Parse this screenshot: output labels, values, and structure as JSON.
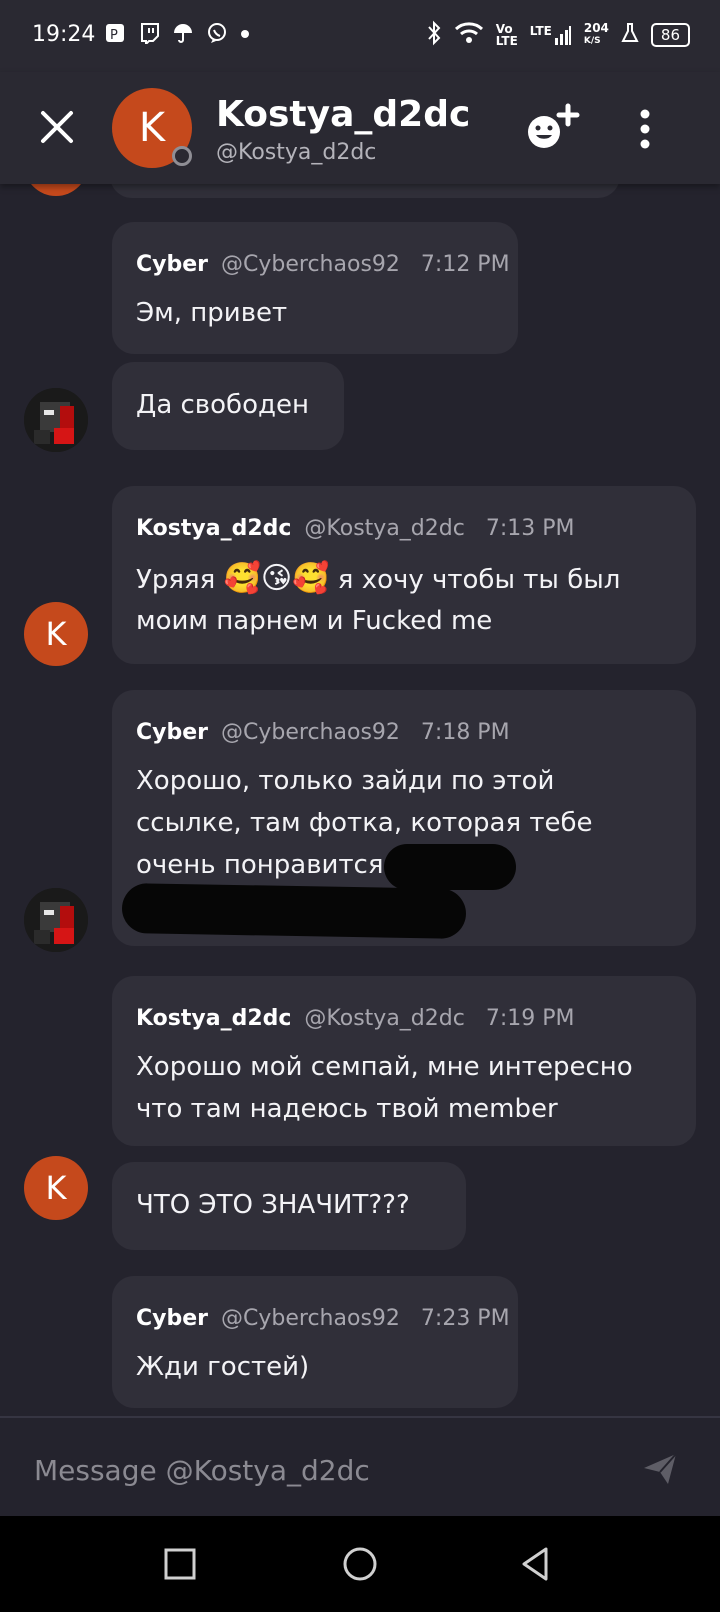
{
  "status_bar": {
    "time": "19:24",
    "left_icons": [
      "app-icon-p",
      "twitch-icon",
      "umbrella-icon",
      "viber-icon",
      "dot"
    ],
    "network_label_1": "Vo",
    "network_label_2": "LTE",
    "lte_label": "LTE",
    "speed_value": "204",
    "speed_unit": "K/S",
    "battery": "86"
  },
  "header": {
    "avatar_letter": "K",
    "name": "Kostya_d2dc",
    "handle": "@Kostya_d2dc"
  },
  "messages": [
    {
      "author": "Cyber",
      "handle": "@Cyberchaos92",
      "time": "7:12 PM",
      "lines": [
        "Эм, привет"
      ]
    },
    {
      "lines": [
        "Да свободен"
      ]
    },
    {
      "author": "Kostya_d2dc",
      "handle": "@Kostya_d2dc",
      "time": "7:13 PM",
      "line1_prefix": "Уряяя ",
      "emoji": "🥰😘🥰",
      "line1_suffix": " я хочу чтобы ты был",
      "line2": "моим парнем и Fucked me"
    },
    {
      "author": "Cyber",
      "handle": "@Cyberchaos92",
      "time": "7:18 PM",
      "lines": [
        "Хорошо, только зайди по этой",
        "ссылке, там фотка, которая тебе",
        "очень понравится"
      ]
    },
    {
      "author": "Kostya_d2dc",
      "handle": "@Kostya_d2dc",
      "time": "7:19 PM",
      "lines": [
        "Хорошо мой семпай, мне интересно",
        "что там надеюсь твой member"
      ]
    },
    {
      "lines": [
        "ЧТО ЭТО ЗНАЧИТ???"
      ]
    },
    {
      "author": "Cyber",
      "handle": "@Cyberchaos92",
      "time": "7:23 PM",
      "lines": [
        "Жди гостей)"
      ]
    }
  ],
  "avatars": {
    "kostya_letter": "K"
  },
  "composer": {
    "placeholder": "Message @Kostya_d2dc"
  },
  "colors": {
    "kostya_avatar": "#c5491c",
    "background": "#24232d",
    "bubble": "#302f39"
  }
}
